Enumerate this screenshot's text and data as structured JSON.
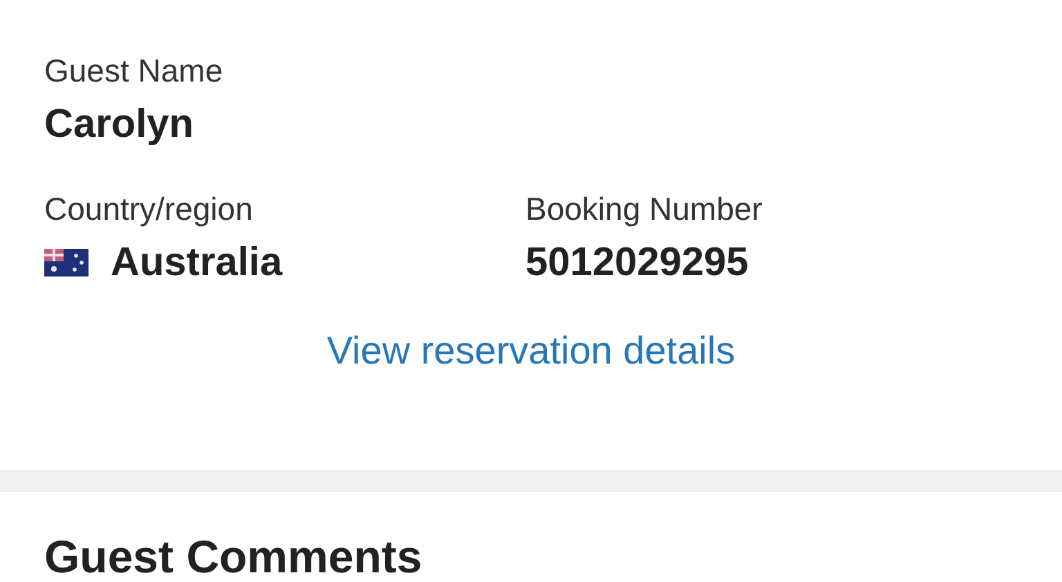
{
  "guest": {
    "label": "Guest Name",
    "value": "Carolyn"
  },
  "fields": [
    {
      "label": "Country/region",
      "value": "Australia",
      "kind": "flag"
    },
    {
      "label": "Booking Number",
      "value": "5012029295",
      "kind": "text"
    }
  ],
  "link": "View reservation details",
  "comments": {
    "title": "Guest Comments"
  }
}
